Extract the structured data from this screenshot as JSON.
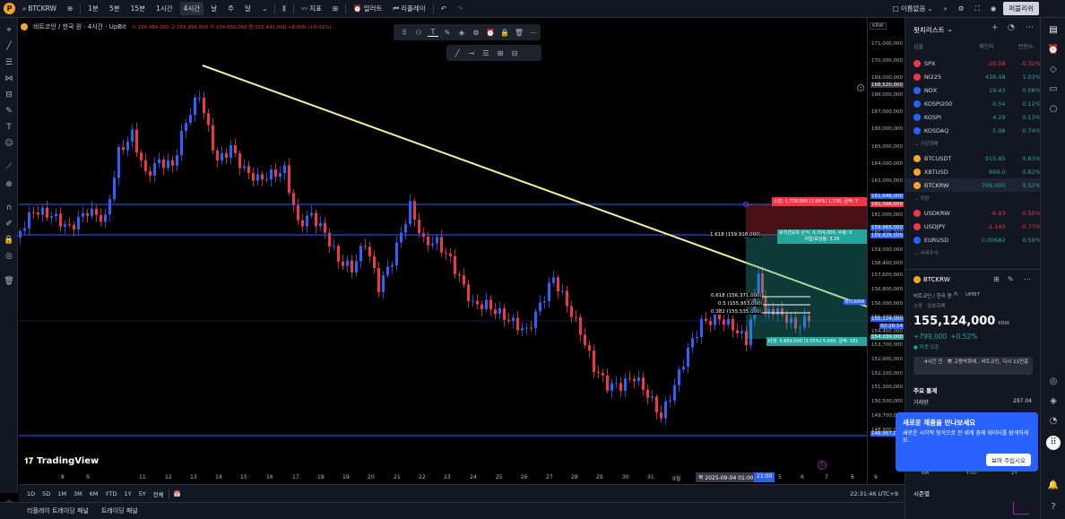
{
  "topbar": {
    "symbol": "BTCKRW",
    "intervals": [
      "1분",
      "5분",
      "15분",
      "1시간",
      "4시간",
      "날",
      "주",
      "달"
    ],
    "active_interval": "4시간",
    "indicators": "지표",
    "alert": "얼러트",
    "replay": "리플레이",
    "unnamed": "이름없음",
    "publish": "퍼블리쉬"
  },
  "legend": {
    "title": "비트코인 / 한국 원 · 4시간 · UpBit",
    "ohlc": "시 155,484,000 고 155,856,000 저 154,650,000 종 155,491,000 +8,000 (+0.01%)"
  },
  "axis": {
    "currency": "KRW",
    "price_labels": [
      "171,000,000",
      "170,000,000",
      "169,000,000",
      "168,000,000",
      "167,000,000",
      "166,000,000",
      "165,000,000",
      "164,000,000",
      "163,000,000",
      "162,000,000",
      "161,000,000",
      "160,000,000",
      "159,000,000",
      "158,400,000",
      "157,600,000",
      "156,800,000",
      "156,000,000",
      "155,200,000",
      "154,400,000",
      "153,700,000",
      "152,900,000",
      "152,100,000",
      "151,300,000",
      "150,500,000",
      "149,700,000",
      "148,900,000"
    ],
    "tags": {
      "top": "168,520,000",
      "stop1": "161,646,000",
      "stop2": "161,566,000",
      "fib1": "159,965,000",
      "fib2": "159,828,000",
      "current": "155,124,000",
      "current_time": "02:28:14",
      "current_symbol": "BTCKRW",
      "tp": "154,159,000",
      "low": "148,957,000"
    },
    "x_labels": [
      "8",
      "9",
      "11",
      "12",
      "13",
      "14",
      "15",
      "16",
      "17",
      "18",
      "19",
      "20",
      "21",
      "22",
      "23",
      "24",
      "25",
      "26",
      "27",
      "28",
      "29",
      "30",
      "31",
      "9월",
      "2",
      "3",
      "4",
      "5",
      "6",
      "7",
      "8",
      "9"
    ],
    "x_cursor_date": "목 2025-09-04  01:00",
    "x_cursor_time": "21:00"
  },
  "chart": {
    "watermark": "TradingView",
    "fib_1618": "1.618 (159,918,000)",
    "fib_0618": "0.618 (156,371,000)",
    "fib_05": "0.5 (155,953,000)",
    "fib_0382": "0.382 (155,535,000)",
    "stop_label": "스탑: 1,738,000 (1.09%) 1,738, 금액: 7",
    "open_label": "포지션보유 손익: 4,704,000, 수량: 0",
    "ratio_label": "위험/보상율: 3.26",
    "target_label": "타겟: 5,669,000 (3.55%) 5,669, 금액: 181",
    "colors": {
      "up": "#2962ff",
      "down": "#f23645",
      "trend": "#f5f0a0",
      "hline": "#2962ff"
    }
  },
  "bottombar": {
    "ranges": [
      "1D",
      "5D",
      "1M",
      "3M",
      "6M",
      "YTD",
      "1Y",
      "5Y",
      "전체"
    ],
    "clock": "22:31:46 UTC+9"
  },
  "status": {
    "tab1": "리플레이 트레이딩 패널",
    "tab2": "트레이딩 패널"
  },
  "watchlist": {
    "title": "왓치리스트",
    "headers": [
      "심볼",
      "체인지",
      "변동%"
    ],
    "rows1": [
      {
        "sym": "SPX",
        "chg": "-20.58",
        "pct": "-0.32%",
        "dir": "dn",
        "color": "#f23645"
      },
      {
        "sym": "NI225",
        "chg": "438.48",
        "pct": "1.03%",
        "dir": "up",
        "color": "#f23645"
      },
      {
        "sym": "NDX",
        "chg": "19.43",
        "pct": "0.08%",
        "dir": "up",
        "color": "#2962ff"
      },
      {
        "sym": "KOSPI200",
        "chg": "0.54",
        "pct": "0.12%",
        "dir": "up",
        "color": "#2962ff"
      },
      {
        "sym": "KOSPI",
        "chg": "4.29",
        "pct": "0.13%",
        "dir": "up",
        "color": "#2962ff"
      },
      {
        "sym": "KOSDAQ",
        "chg": "5.98",
        "pct": "0.74%",
        "dir": "up",
        "color": "#2962ff"
      }
    ],
    "section2": "가상화폐",
    "rows2": [
      {
        "sym": "BTCUSDT",
        "chg": "915.85",
        "pct": "0.83%",
        "dir": "up",
        "color": "#f5a623"
      },
      {
        "sym": "XBTUSD",
        "chg": "899.0",
        "pct": "0.82%",
        "dir": "up",
        "color": "#f5a623"
      },
      {
        "sym": "BTCKRW",
        "chg": "799,000",
        "pct": "0.52%",
        "dir": "up",
        "color": "#f5a623"
      }
    ],
    "section3": "외환",
    "rows3": [
      {
        "sym": "USDKRW",
        "chg": "-6.93",
        "pct": "-0.50%",
        "dir": "dn",
        "color": "#f23645"
      },
      {
        "sym": "USDJPY",
        "chg": "-1.140",
        "pct": "-0.77%",
        "dir": "dn",
        "color": "#f23645"
      },
      {
        "sym": "EURUSD",
        "chg": "0.00682",
        "pct": "0.59%",
        "dir": "up",
        "color": "#2962ff"
      }
    ],
    "section4": "국내주식"
  },
  "detail": {
    "symbol": "BTCKRW",
    "name": "비트코인 / 한국 원",
    "exchange": "UPBIT",
    "type": "스팟 · 암호화폐",
    "price": "155,124,000",
    "currency": "KRW",
    "change": "+799,000",
    "change_pct": "+0.52%",
    "market": "● 마켓 오픈",
    "news": "4시간 전 · 美 고용악화에...비트코인, 다시 11만흥",
    "stats_title": "주요 통계",
    "vol_label": "거래량",
    "vol_value": "297.04",
    "period_tabs": [
      "6M",
      "YTD",
      "1Y"
    ],
    "season": "시즌별"
  },
  "popup": {
    "title": "새로운 제품을 만나보세요",
    "body": "새로운 시각적 형식으로 전 세계 경제 데이터를 탐색하세요.",
    "button": "보여 주십시오"
  }
}
